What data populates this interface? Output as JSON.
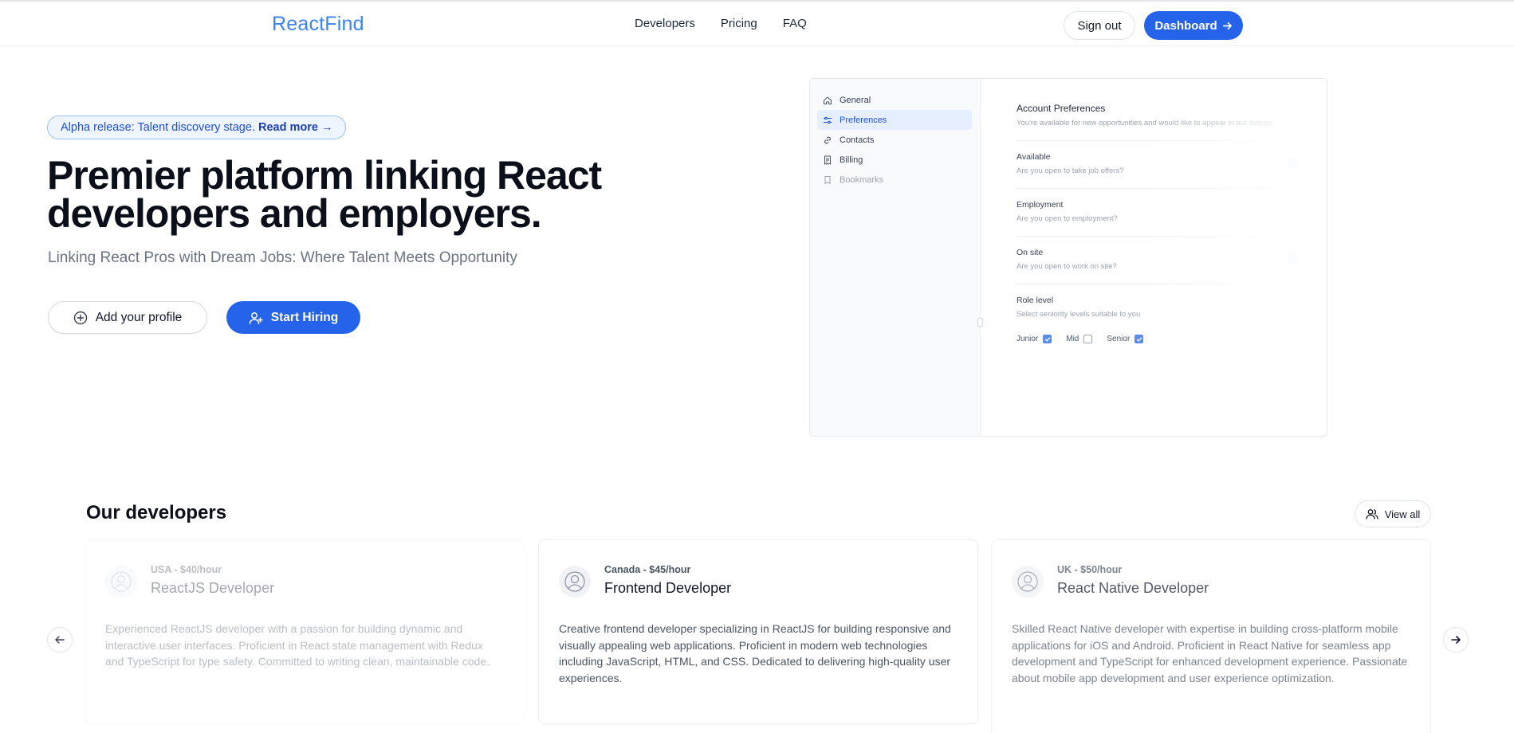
{
  "header": {
    "logo": "ReactFind",
    "nav": [
      "Developers",
      "Pricing",
      "FAQ"
    ],
    "signout_label": "Sign out",
    "dashboard_label": "Dashboard"
  },
  "hero": {
    "badge_text": "Alpha release: Talent discovery stage.",
    "badge_link": "Read more",
    "title": "Premier platform linking React developers and employers.",
    "subtitle": "Linking React Pros with Dream Jobs: Where Talent Meets Opportunity",
    "add_profile_label": "Add your profile",
    "start_hiring_label": "Start Hiring"
  },
  "preview": {
    "sidebar": [
      {
        "label": "General",
        "icon": "home-icon"
      },
      {
        "label": "Preferences",
        "icon": "sliders-icon",
        "active": true
      },
      {
        "label": "Contacts",
        "icon": "link-icon"
      },
      {
        "label": "Billing",
        "icon": "receipt-icon"
      },
      {
        "label": "Bookmarks",
        "icon": "bookmark-icon"
      }
    ],
    "heading": "Account Preferences",
    "description": "You're available for new opportunities and would like to appear in our listings.",
    "rows": [
      {
        "label": "Available",
        "sub": "Are you open to take job offers?",
        "on": true
      },
      {
        "label": "Employment",
        "sub": "Are you open to employment?",
        "on": false
      },
      {
        "label": "On site",
        "sub": "Are you open to work on site?",
        "on": true
      }
    ],
    "role": {
      "label": "Role level",
      "sub": "Select seniority levels suitable to you",
      "options": [
        {
          "label": "Junior",
          "checked": true
        },
        {
          "label": "Mid",
          "checked": false
        },
        {
          "label": "Senior",
          "checked": true
        }
      ]
    }
  },
  "developers": {
    "title": "Our developers",
    "view_all_label": "View all",
    "cards": [
      {
        "meta": "USA - $40/hour",
        "role": "ReactJS Developer",
        "description": "Experienced ReactJS developer with a passion for building dynamic and interactive user interfaces. Proficient in React state management with Redux and TypeScript for type safety. Committed to writing clean, maintainable code."
      },
      {
        "meta": "Canada - $45/hour",
        "role": "Frontend Developer",
        "description": "Creative frontend developer specializing in ReactJS for building responsive and visually appealing web applications. Proficient in modern web technologies including JavaScript, HTML, and CSS. Dedicated to delivering high-quality user experiences."
      },
      {
        "meta": "UK - $50/hour",
        "role": "React Native Developer",
        "description": "Skilled React Native developer with expertise in building cross-platform mobile applications for iOS and Android. Proficient in React Native for seamless app development and TypeScript for enhanced development experience. Passionate about mobile app development and user experience optimization."
      }
    ]
  },
  "colors": {
    "accent": "#2563eb",
    "logo": "#3b82f6"
  }
}
